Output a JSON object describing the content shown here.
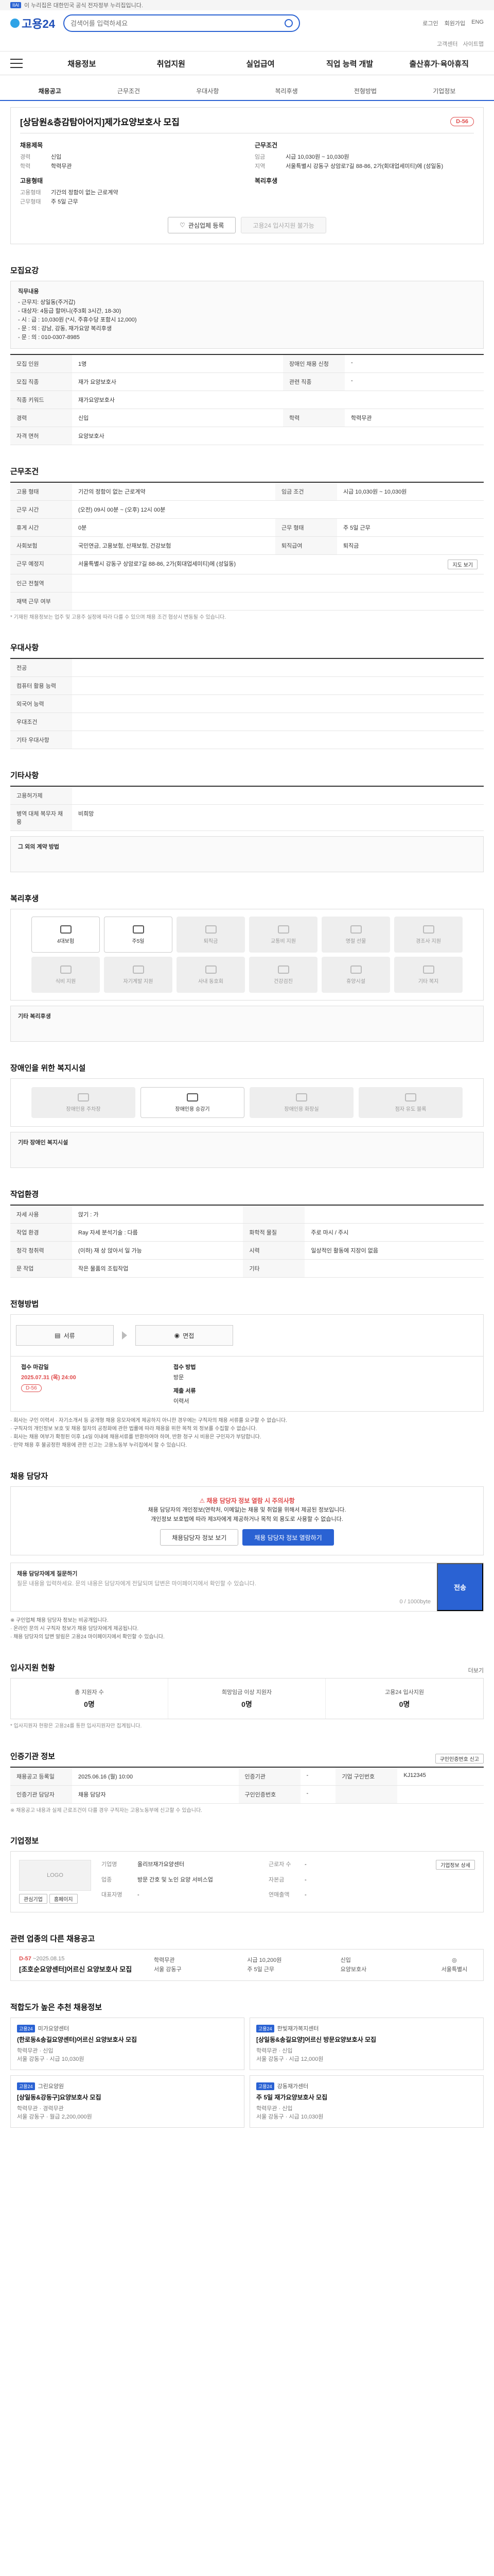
{
  "topbar": {
    "badge": "IIAl",
    "text": "이 누리집은 대한민국 공식 전자정부 누리집입니다."
  },
  "header": {
    "logo": "고용24",
    "search_placeholder": "검색어를 입력하세요",
    "right_links": [
      "로그인",
      "회원가입",
      "ENG"
    ],
    "sub_links": [
      "고객센터",
      "사이트맵"
    ]
  },
  "gnb": {
    "items": [
      "채용정보",
      "취업지원",
      "실업급여",
      "직업 능력 개발",
      "출산휴가·육아휴직"
    ]
  },
  "tabs": [
    "채용공고",
    "근무조건",
    "우대사항",
    "복리후생",
    "전형방법",
    "기업정보"
  ],
  "job": {
    "title": "[상담원&층감탐아어지]제가요양보호사 모집",
    "dday": "D-56",
    "recruit_title": "채용제목",
    "recruit_rows": [
      {
        "k": "경력",
        "v": "신입"
      },
      {
        "k": "학력",
        "v": "학력무관"
      }
    ],
    "condition_title": "근무조건",
    "condition_rows": [
      {
        "k": "임금",
        "v": "시급 10,030원 ~ 10,030원"
      },
      {
        "k": "지역",
        "v": "서울특별시 강동구 상암로7길 88-86, 2가(회대업세미티)에 (성일동)"
      }
    ],
    "employ_title": "고용형태",
    "employ_rows": [
      {
        "k": "고용형태",
        "v": "기간의 정함이 없는 근로계약"
      },
      {
        "k": "근무형태",
        "v": "주 5일 근무"
      }
    ],
    "welfare_title": "복리후생",
    "btn_interest": "관심업체 등록",
    "btn_apply": "고용24 입사지원 불가능"
  },
  "recruit": {
    "heading": "모집요강",
    "notice_title": "직무내용",
    "notice_lines": [
      "- 근무지: 상일동(주거갑)",
      "- 대상자: 4등급 할머니(주3회 3시간, 18-30)",
      "- 시 : 급 : 10,030원 (*시, 주휴수당 포함시 12,000)",
      "- 문 : 의 : 강남, 강동, 재가요양 복리후생",
      "- 문 : 의 : 010-0307-8985"
    ],
    "rows": [
      {
        "k": "모집 인원",
        "v": "1명",
        "k2": "장애인 채용 신청",
        "v2": "-"
      },
      {
        "k": "모집 직종",
        "v": "재가 요양보호사",
        "k2": "관련 직종",
        "v2": "-"
      },
      {
        "k": "직종 키워드",
        "v": "재가요양보호사",
        "k2": "",
        "v2": ""
      },
      {
        "k": "경력",
        "v": "신입",
        "k2": "학력",
        "v2": "학력무관"
      },
      {
        "k": "자격 면허",
        "v": "요양보호사",
        "k2": "",
        "v2": ""
      }
    ]
  },
  "work": {
    "heading": "근무조건",
    "rows": [
      {
        "k": "고용 형태",
        "v": "기간의 정함이 없는 근로계약",
        "k2": "임금 조건",
        "v2": "시급 10,030원 ~ 10,030원"
      },
      {
        "k": "근무 시간",
        "v": "(오전) 09시 00분 ~ (오후) 12시 00분",
        "k2": "",
        "v2": ""
      },
      {
        "k": "휴게 시간",
        "v": "0분",
        "k2": "근무 형태",
        "v2": "주 5일 근무"
      },
      {
        "k": "사회보험",
        "v": "국민연금, 고용보험, 산재보험, 건강보험",
        "k2": "퇴직급여",
        "v2": "퇴직금"
      },
      {
        "k": "근무 예정지",
        "v": "서울특별시 강동구 상암로7길 88-86, 2가(회대업세미티)에 (성일동)",
        "k2": "",
        "v2": ""
      },
      {
        "k": "인근 전철역",
        "v": "",
        "k2": "",
        "v2": ""
      },
      {
        "k": "재택 근무 여부",
        "v": "",
        "k2": "",
        "v2": ""
      }
    ],
    "map_btn": "지도 보기",
    "footnote": "* 기재된 채용정보는 업주 및 고용주 실정에 따라 다를 수 있으며 채용 조건 협상시 변동될 수 있습니다."
  },
  "pref": {
    "heading": "우대사항",
    "rows": [
      {
        "k": "전공",
        "v": ""
      },
      {
        "k": "컴퓨터 활용 능력",
        "v": ""
      },
      {
        "k": "외국어 능력",
        "v": ""
      },
      {
        "k": "우대조건",
        "v": ""
      },
      {
        "k": "기타 우대사항",
        "v": ""
      }
    ]
  },
  "etc": {
    "heading": "기타사항",
    "rows": [
      {
        "k": "고용허가제",
        "v": ""
      },
      {
        "k": "병역 대체 복무자 채용",
        "v": "비희망"
      }
    ],
    "extra_k": "그 외의 계약 방법",
    "extra_v": ""
  },
  "welfare": {
    "heading": "복리후생",
    "items": [
      "4대보험",
      "주5일",
      "퇴직금",
      "교통비 지원",
      "명절 선물",
      "경조사 지원",
      "식비 지원",
      "자기계발 지원",
      "사내 동호회",
      "건강검진",
      "휴양시설",
      "기타 복지"
    ],
    "active": [
      0,
      1
    ],
    "extra_k": "기타 복리후생",
    "extra_v": ""
  },
  "disabled": {
    "heading": "장애인을 위한 복지시설",
    "items": [
      "장애인용 주차장",
      "장애인용 승강기",
      "장애인용 화장실",
      "점자 유도 블록"
    ],
    "extra_k": "기타 장애인 복지시설",
    "extra_v": ""
  },
  "screening": {
    "heading": "작업환경",
    "rows": [
      {
        "k": "자세 사용",
        "v": "앉기 : 가",
        "k2": "",
        "v2": ""
      },
      {
        "k": "작업 환경",
        "v": "Ray 자세 분석기술 : 다름",
        "k2": "화학적 물질",
        "v2": "주로 마시 / 주시"
      },
      {
        "k": "청각 청취력",
        "v": "(이하) 재 상 앉아서 일 가능",
        "k2": "시력",
        "v2": "일상적인 활동에 지장이 없음"
      },
      {
        "k": "문 작업",
        "v": "작은 물품의 조립작업",
        "k2": "기타",
        "v2": ""
      }
    ]
  },
  "method": {
    "heading": "전형방법",
    "steps": [
      "서류",
      "면접"
    ],
    "deadline_label": "접수 마감일",
    "deadline_value": "2025.07.31 (목) 24:00",
    "deadline_tag": "D-56",
    "way_label": "접수 방법",
    "way_value": "방문",
    "doc_label": "제출 서류",
    "doc_value": "이력서",
    "notes": [
      "· 회사는 구인 이력서 · 자기소개서 등 공개형 채용 응모자에게 제공하지 아니한 경우에는 구직자의 채용 서류를 요구할 수 없습니다.",
      "· 구직자의 개인정보 보호 및 채용 절차의 공정화에 관한 법률에 따라 채용을 위한 목적 외 정보를 수집할 수 없습니다.",
      "· 회사는 채용 여부가 확정된 이후 14일 이내에 채용서류를 반환하여야 하며, 반환 청구 시 비용은 구인자가 부담합니다.",
      "· 만약 채용 후 불공정한 채용에 관한 신고는 고용노동부 누리집에서 할 수 있습니다."
    ]
  },
  "contact": {
    "heading": "채용 담당자",
    "warn": "채용 담당자 정보 열람 시 주의사항",
    "lines": [
      "채용 담당자의 개인정보(연락처, 이메일)는 채용 및 취업을 위해서 제공된 정보입니다.",
      "개인정보 보호법에 따라 제3자에게 제공하거나 목적 외 용도로 사용할 수 없습니다."
    ],
    "btn_detail": "채용담당자 정보 보기",
    "btn_login": "채용 담당자 정보 열람하기",
    "inquiry_title": "채용 담당자에게 질문하기",
    "inquiry_placeholder": "질문 내용을 입력하세요. 문의 내용은 담당자에게 전달되며 답변은 마이페이지에서 확인할 수 있습니다.",
    "counter": "0 / 1000byte",
    "send": "전송",
    "footnotes": [
      "※ 구인업체 채용 담당자 정보는 비공개입니다.",
      "· 온라인 문의 시 구직자 정보가 채용 담당자에게 제공됩니다.",
      "· 채용 담당자의 답변 알림은 고용24 마이페이지에서 확인할 수 있습니다."
    ]
  },
  "apply_status": {
    "heading": "입사지원 현황",
    "more": "더보기",
    "cells": [
      {
        "label": "총 지원자 수",
        "value": "0명"
      },
      {
        "label": "희망임금 이상 지원자",
        "value": "0명"
      },
      {
        "label": "고용24 입사지원",
        "value": "0명"
      }
    ],
    "note": "* 입사지원자 현황은 고용24를 통한 입사지원자만 집계됩니다."
  },
  "mgmt": {
    "heading": "인증기관 정보",
    "btn": "구인인증번호 신고",
    "rows": [
      {
        "k": "채용공고 등록일",
        "v": "2025.06.16 (월) 10:00",
        "k2": "인증기관",
        "v2": "-",
        "k3": "기업 구인번호",
        "v3": "KJ12345"
      },
      {
        "k": "인증기관 담당자",
        "v": "채용 담당자",
        "k2": "구인인증번호",
        "v2": "-",
        "k3": "",
        "v3": ""
      }
    ],
    "note": "※ 채용공고 내용과 실제 근로조건이 다를 경우 구직자는 고용노동부에 신고할 수 있습니다."
  },
  "company": {
    "heading": "기업정보",
    "logo": "LOGO",
    "btn_interest": "관심기업",
    "btn_homepage": "홈페이지",
    "info": [
      {
        "k": "기업명",
        "v": "올리브재가요양센터"
      },
      {
        "k": "업종",
        "v": "방문 간호 및 노인 요양 서비스업"
      },
      {
        "k": "대표자명",
        "v": "-"
      },
      {
        "k": "근로자 수",
        "v": "-"
      },
      {
        "k": "자본금",
        "v": "-"
      },
      {
        "k": "연매출액",
        "v": "-"
      }
    ],
    "info_btn": "기업정보 상세"
  },
  "similar": {
    "heading": "관련 업종의 다른 채용공고",
    "dday": "D-57",
    "date": "~2025.08.15",
    "title": "[조호순요양센터]어르신 요양보호사 모집",
    "col1": [
      "학력무관",
      "서울 강동구"
    ],
    "col2": [
      "시급 10,200원",
      "주 5일 근무"
    ],
    "col3": [
      "신입",
      "요양보호사"
    ],
    "agency": "서울특별시"
  },
  "recommend": {
    "heading": "적합도가 높은 추천 채용정보",
    "cards": [
      {
        "badge": "고용24",
        "company": "미가요양센터",
        "title": "(한로동&송길요양센터)어르신 요양보호사 모집",
        "meta": [
          "학력무관 · 신입",
          "서울 강동구 · 시급 10,030원"
        ]
      },
      {
        "badge": "고용24",
        "company": "한빛재가복지센터",
        "title": "[상일동&송길요양]어르신 방문요양보호사 모집",
        "meta": [
          "학력무관 · 신입",
          "서울 강동구 · 시급 12,000원"
        ]
      },
      {
        "badge": "고용24",
        "company": "그린요양원",
        "title": "[상일동&강동구]요양보호사 모집",
        "meta": [
          "학력무관 · 경력무관",
          "서울 강동구 · 월급 2,200,000원"
        ]
      },
      {
        "badge": "고용24",
        "company": "강동재가센터",
        "title": "주 5일 재가요양보호사 모집",
        "meta": [
          "학력무관 · 신입",
          "서울 강동구 · 시급 10,030원"
        ]
      }
    ]
  }
}
